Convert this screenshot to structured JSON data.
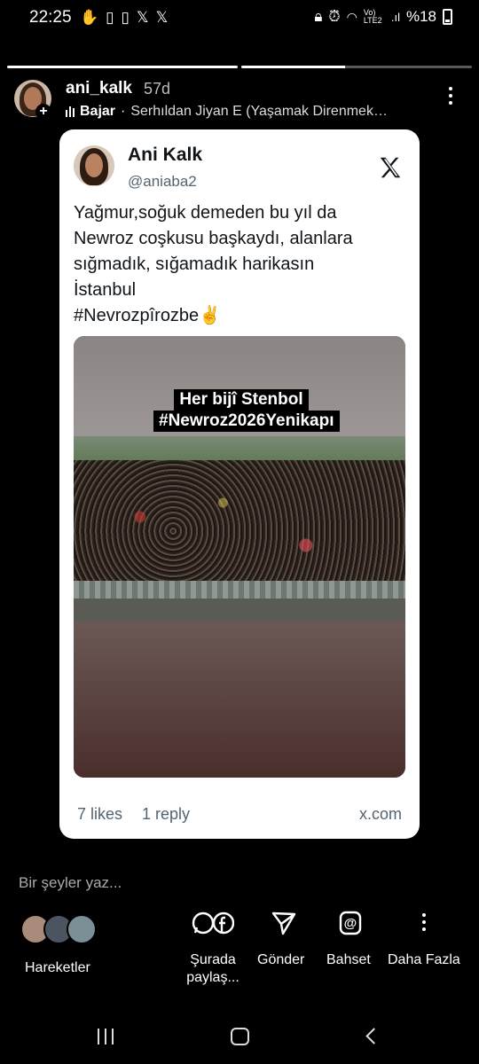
{
  "status_bar": {
    "time": "22:25",
    "battery": "%18",
    "network": "Vo) LTE2",
    "left_icons": [
      "hand-icon",
      "sim-icon",
      "sim-icon",
      "x-notification-icon",
      "x-notification-icon"
    ],
    "right_icons": [
      "lock-icon",
      "alarm-icon",
      "wifi-icon",
      "signal-icon",
      "battery-icon"
    ]
  },
  "story": {
    "progress_segments": [
      {
        "fill": 1.0
      },
      {
        "fill": 0.45
      }
    ]
  },
  "header": {
    "username": "ani_kalk",
    "age": "57d",
    "music_label": "Bajar",
    "music_track": "Serhıldan Jiyan E (Yaşamak Direnmek…"
  },
  "tweet": {
    "author": "Ani Kalk",
    "handle": "@aniaba2",
    "text": "Yağmur,soğuk  demeden bu yıl da\nNewroz coşkusu başkaydı, alanlara\nsığmadık, sığamadık harikasın\nİstanbul\n#Nevrozpîrozbe✌️",
    "media_caption_line1": "Her bijî Stenbol",
    "media_caption_line2": "#Newroz2026Yenikapı",
    "likes": "7 likes",
    "replies": "1 reply",
    "source": "x.com"
  },
  "reply": {
    "placeholder": "Bir şeyler yaz..."
  },
  "actions": {
    "activity": "Hareketler",
    "share_line1": "Şurada",
    "share_line2": "paylaş...",
    "send": "Gönder",
    "mention": "Bahset",
    "more": "Daha Fazla"
  },
  "colors": {
    "background": "#000000",
    "card": "#ffffff",
    "text_secondary": "#536471"
  }
}
